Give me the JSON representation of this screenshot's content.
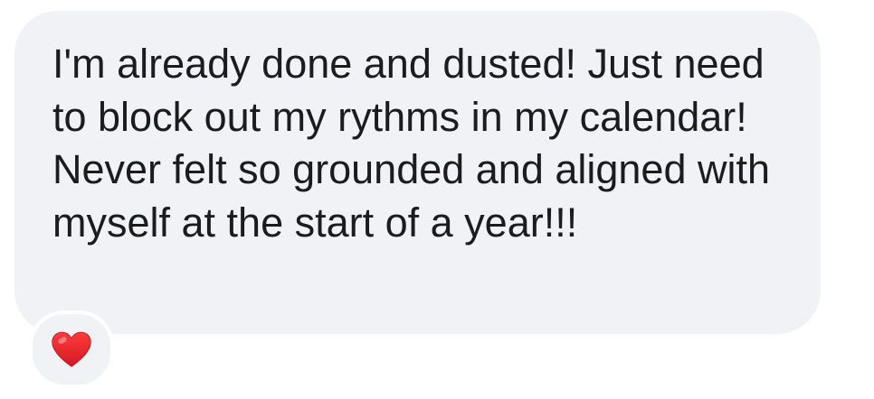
{
  "message": {
    "text": "I'm already done and dusted! Just need to block out my rythms in my calendar! Never felt so grounded and aligned with myself at the start of a year!!!"
  },
  "reaction": {
    "icon": "heart-icon",
    "color": "#e0282e"
  },
  "colors": {
    "bubble_background": "#f1f2f5",
    "text": "#1c1c1e",
    "page_background": "#ffffff"
  }
}
